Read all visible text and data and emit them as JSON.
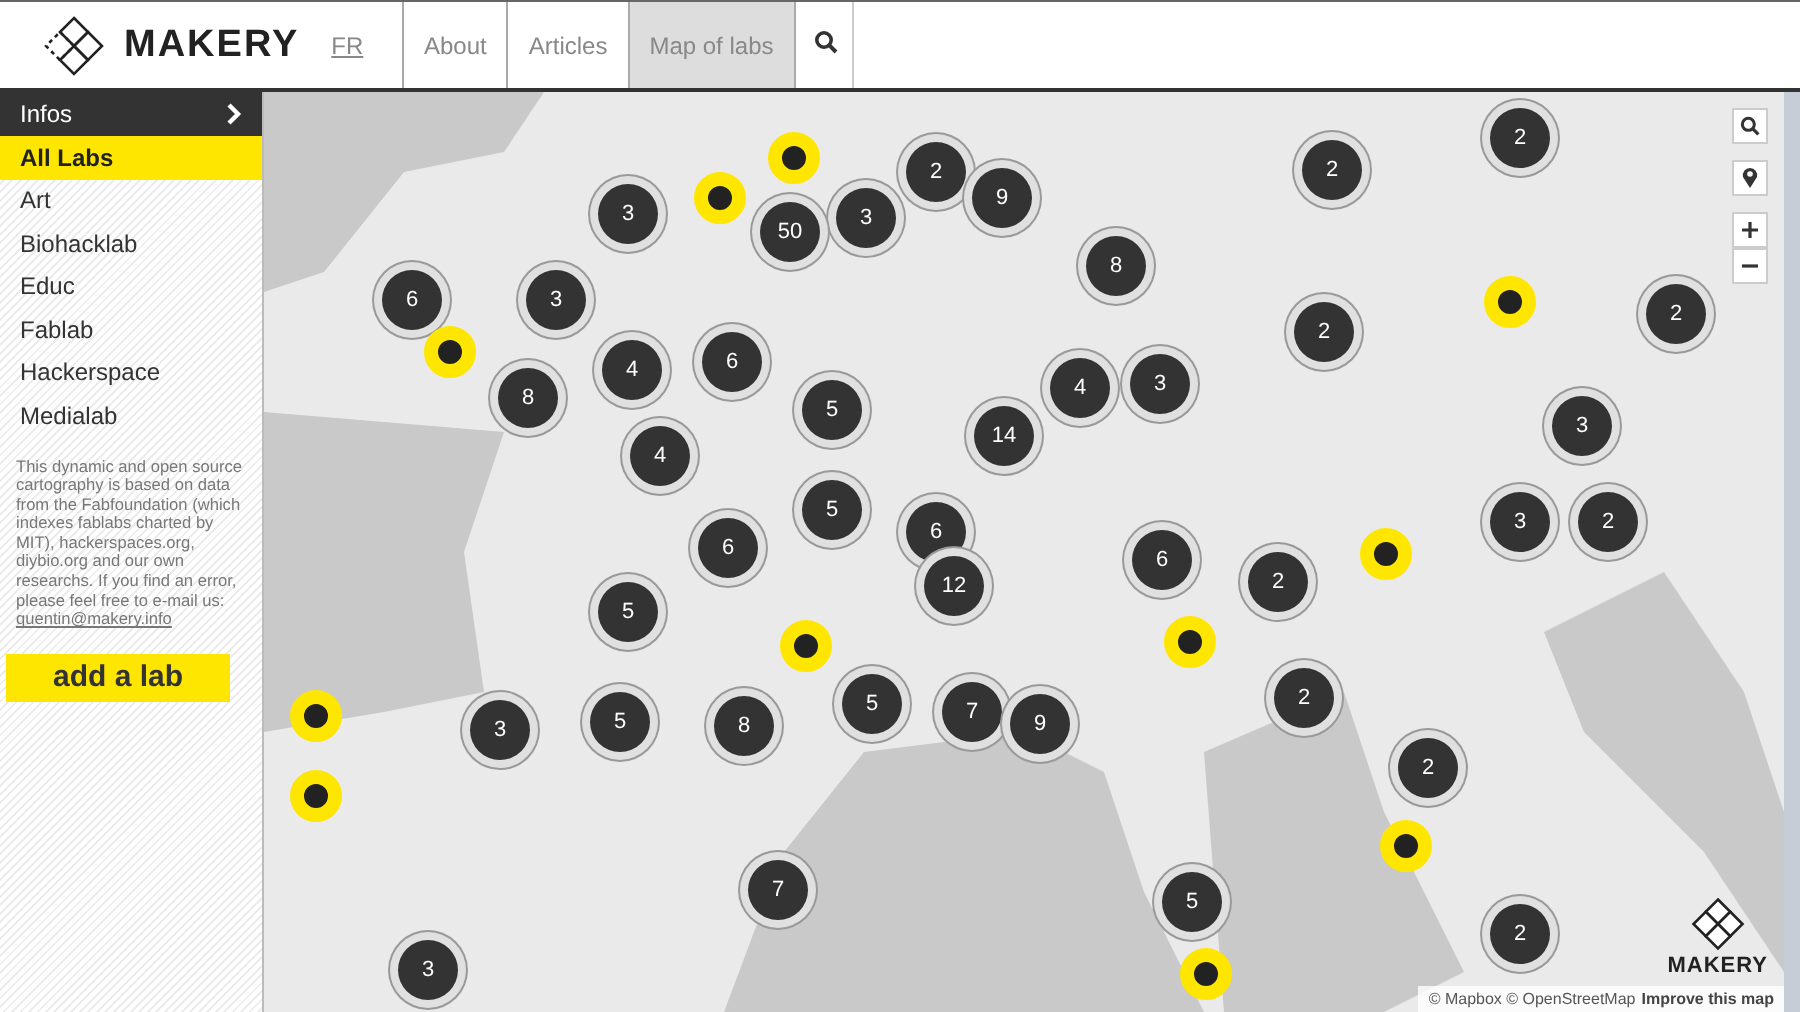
{
  "header": {
    "logo": "MAKERY",
    "language": "FR",
    "nav": [
      {
        "label": "About",
        "selected": false
      },
      {
        "label": "Articles",
        "selected": false
      },
      {
        "label": "Map of labs",
        "selected": true
      }
    ]
  },
  "sidebar": {
    "infos": "Infos",
    "categories": [
      {
        "label": "All Labs",
        "selected": true
      },
      {
        "label": "Art",
        "selected": false
      },
      {
        "label": "Biohacklab",
        "selected": false
      },
      {
        "label": "Educ",
        "selected": false
      },
      {
        "label": "Fablab",
        "selected": false
      },
      {
        "label": "Hackerspace",
        "selected": false
      },
      {
        "label": "Medialab",
        "selected": false
      }
    ],
    "description": "This dynamic and open source cartography is based on data from the Fabfoundation (which indexes fablabs charted by MIT), hackerspaces.org, diybio.org and our own researchs. If you find an error, please feel free to e-mail us:",
    "email": "quentin@makery.info",
    "add_button": "add a lab"
  },
  "map": {
    "markers": [
      {
        "kind": "cluster",
        "count": "2"
      },
      {
        "kind": "cluster",
        "count": "2"
      },
      {
        "kind": "cluster",
        "count": "2"
      },
      {
        "kind": "lab"
      },
      {
        "kind": "lab"
      },
      {
        "kind": "cluster",
        "count": "3"
      },
      {
        "kind": "cluster",
        "count": "3"
      },
      {
        "kind": "cluster",
        "count": "50"
      },
      {
        "kind": "cluster",
        "count": "9"
      },
      {
        "kind": "cluster",
        "count": "8"
      },
      {
        "kind": "cluster",
        "count": "6"
      },
      {
        "kind": "cluster",
        "count": "3"
      },
      {
        "kind": "lab"
      },
      {
        "kind": "cluster",
        "count": "2"
      },
      {
        "kind": "cluster",
        "count": "2"
      },
      {
        "kind": "lab"
      },
      {
        "kind": "cluster",
        "count": "6"
      },
      {
        "kind": "cluster",
        "count": "4"
      },
      {
        "kind": "cluster",
        "count": "3"
      },
      {
        "kind": "cluster",
        "count": "4"
      },
      {
        "kind": "cluster",
        "count": "8"
      },
      {
        "kind": "cluster",
        "count": "5"
      },
      {
        "kind": "cluster",
        "count": "3"
      },
      {
        "kind": "cluster",
        "count": "14"
      },
      {
        "kind": "cluster",
        "count": "4"
      },
      {
        "kind": "cluster",
        "count": "5"
      },
      {
        "kind": "cluster",
        "count": "3"
      },
      {
        "kind": "cluster",
        "count": "2"
      },
      {
        "kind": "cluster",
        "count": "6"
      },
      {
        "kind": "cluster",
        "count": "6"
      },
      {
        "kind": "lab"
      },
      {
        "kind": "cluster",
        "count": "6"
      },
      {
        "kind": "cluster",
        "count": "2"
      },
      {
        "kind": "cluster",
        "count": "12"
      },
      {
        "kind": "cluster",
        "count": "5"
      },
      {
        "kind": "lab"
      },
      {
        "kind": "lab"
      },
      {
        "kind": "lab"
      },
      {
        "kind": "cluster",
        "count": "3"
      },
      {
        "kind": "cluster",
        "count": "5"
      },
      {
        "kind": "cluster",
        "count": "8"
      },
      {
        "kind": "cluster",
        "count": "5"
      },
      {
        "kind": "cluster",
        "count": "7"
      },
      {
        "kind": "cluster",
        "count": "9"
      },
      {
        "kind": "cluster",
        "count": "2"
      },
      {
        "kind": "cluster",
        "count": "2"
      },
      {
        "kind": "lab"
      },
      {
        "kind": "lab"
      },
      {
        "kind": "cluster",
        "count": "7"
      },
      {
        "kind": "cluster",
        "count": "5"
      },
      {
        "kind": "cluster",
        "count": "2"
      },
      {
        "kind": "cluster",
        "count": "3"
      },
      {
        "kind": "lab"
      }
    ],
    "watermark_logo": "MAKERY",
    "attribution": "© Mapbox © OpenStreetMap",
    "improve_link": "Improve this map"
  }
}
